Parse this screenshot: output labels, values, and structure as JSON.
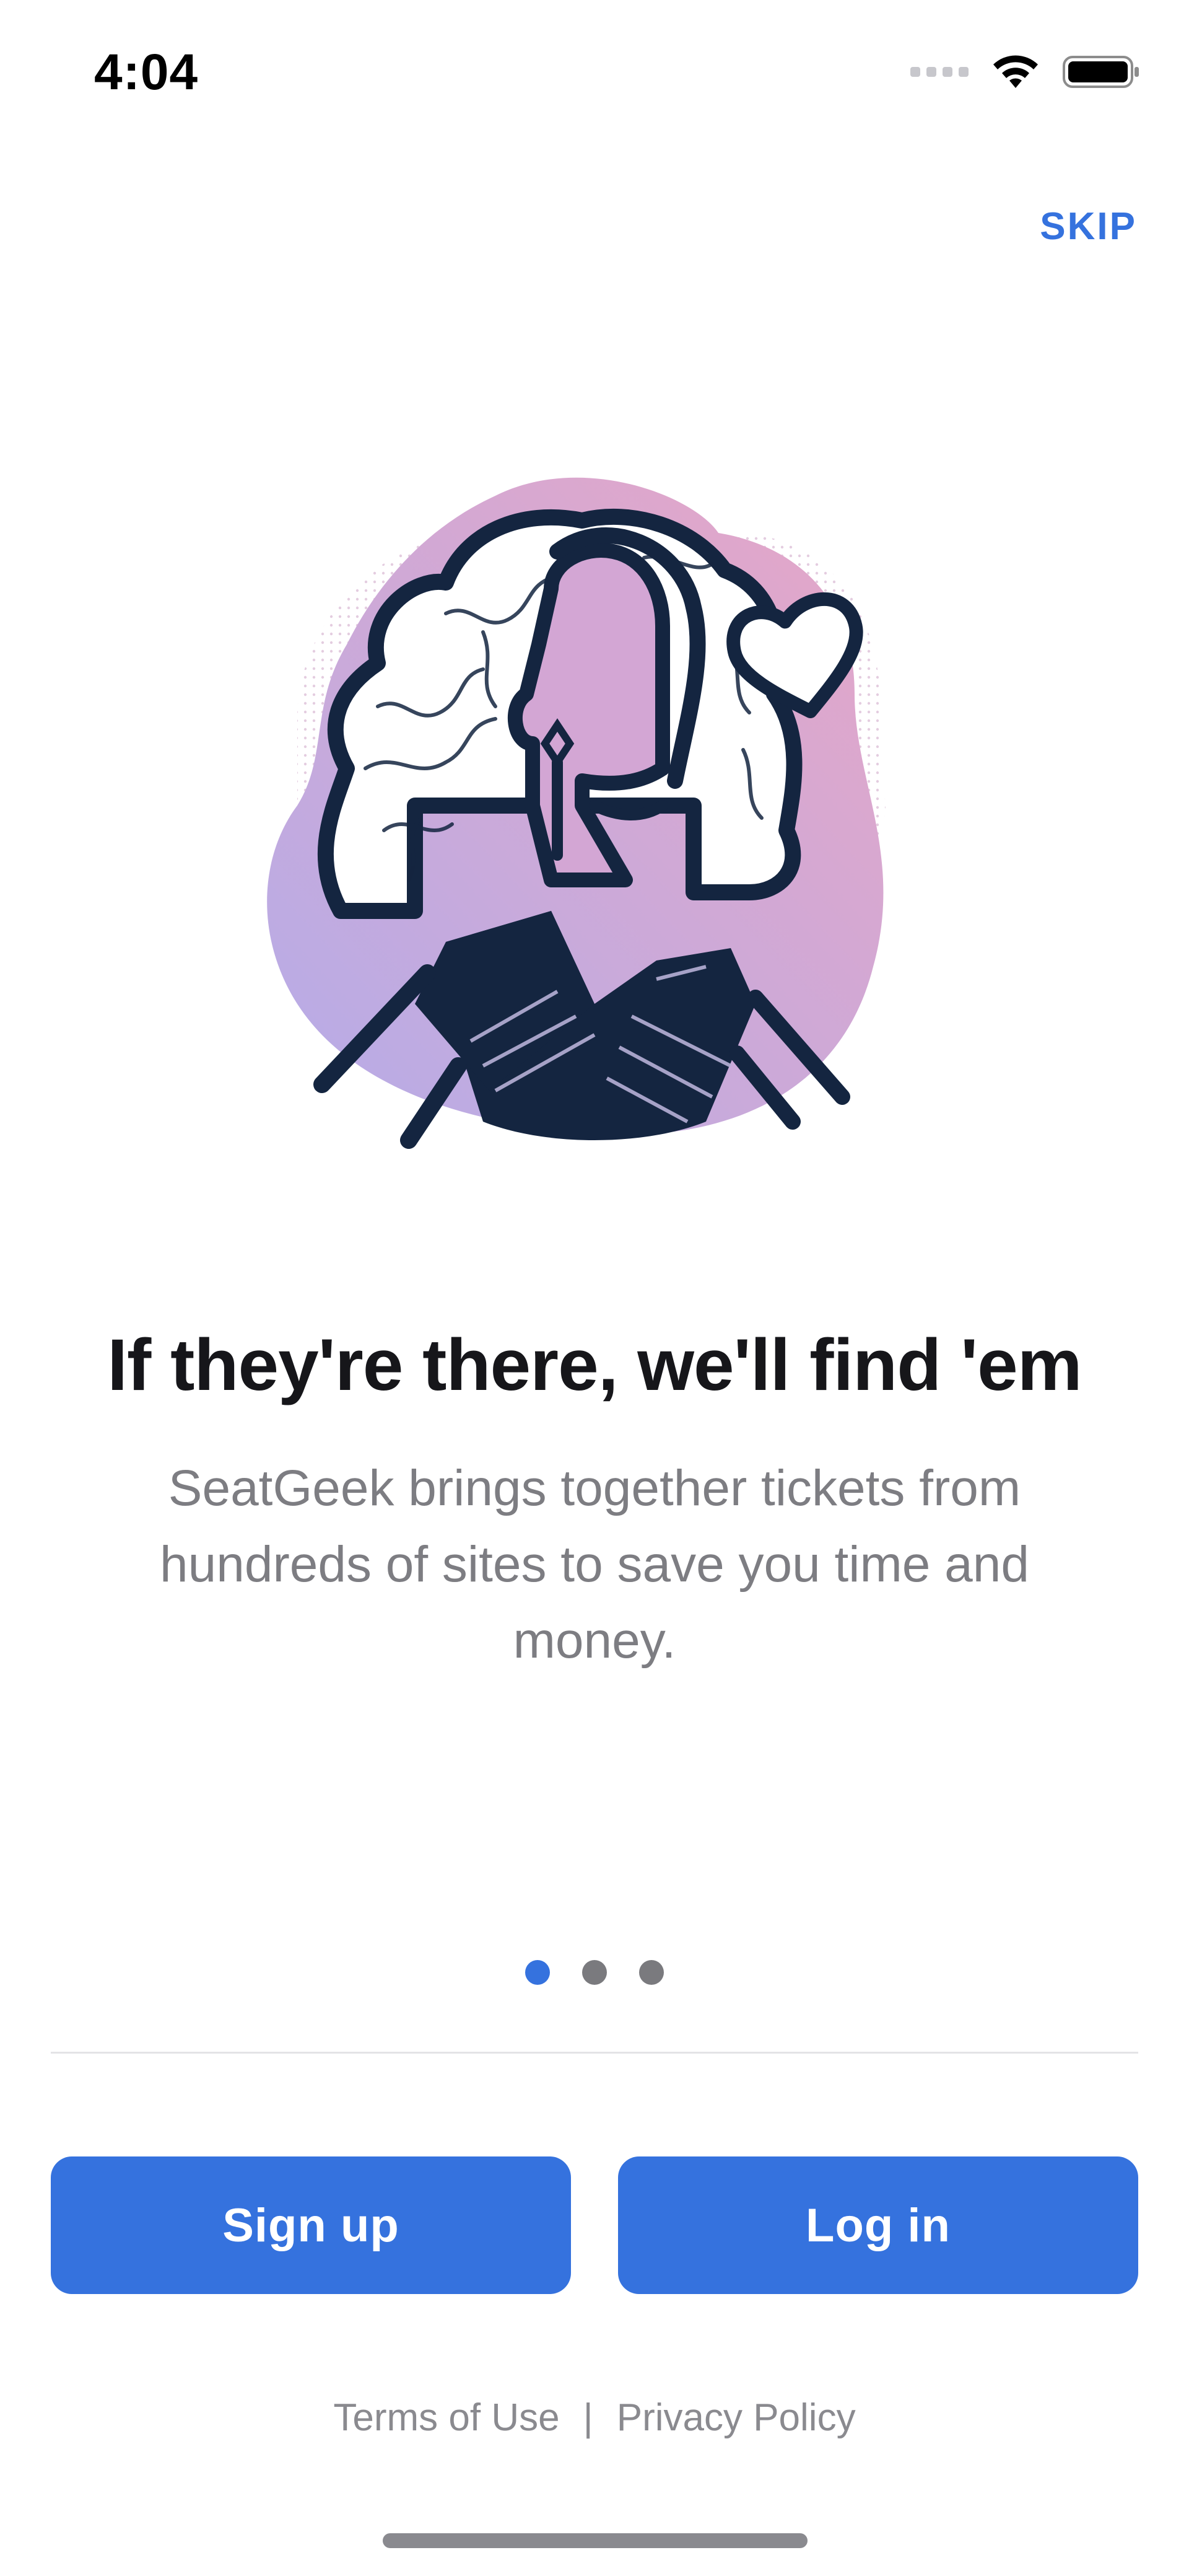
{
  "status_bar": {
    "time": "4:04",
    "icons": [
      "signal-icon",
      "wifi-icon",
      "battery-icon"
    ]
  },
  "skip_label": "SKIP",
  "illustration": {
    "icon": "woman-illustration",
    "colors": {
      "blob_pink": "#e4a9c9",
      "blob_purple": "#b9aae6",
      "ink": "#142540",
      "heart": "#142540"
    }
  },
  "onboarding": {
    "title": "If they're there, we'll find 'em",
    "description": "SeatGeek brings together tickets from hundreds of sites to save you time and money.",
    "page_count": 3,
    "current_page": 1
  },
  "buttons": {
    "signup_label": "Sign up",
    "login_label": "Log in"
  },
  "footer": {
    "terms_label": "Terms of Use",
    "separator": "|",
    "privacy_label": "Privacy Policy"
  },
  "colors": {
    "accent": "#3572de",
    "text_primary": "#16161a",
    "text_secondary": "#7d7d82"
  }
}
